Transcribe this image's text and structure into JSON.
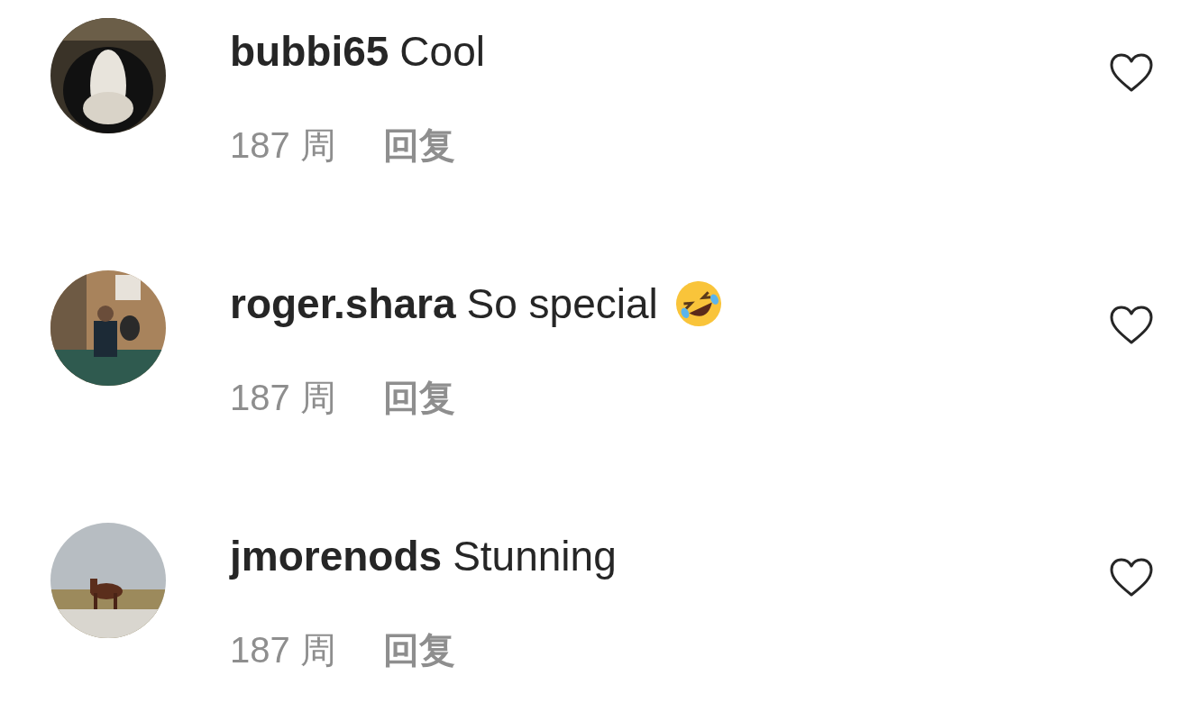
{
  "comments": [
    {
      "username": "bubbi65",
      "text": "Cool",
      "emoji": false,
      "time": "187 周",
      "reply": "回复",
      "liked": false
    },
    {
      "username": "roger.shara",
      "text": "So special",
      "emoji": true,
      "time": "187 周",
      "reply": "回复",
      "liked": false
    },
    {
      "username": "jmorenods",
      "text": "Stunning",
      "emoji": false,
      "time": "187 周",
      "reply": "回复",
      "liked": false
    }
  ]
}
